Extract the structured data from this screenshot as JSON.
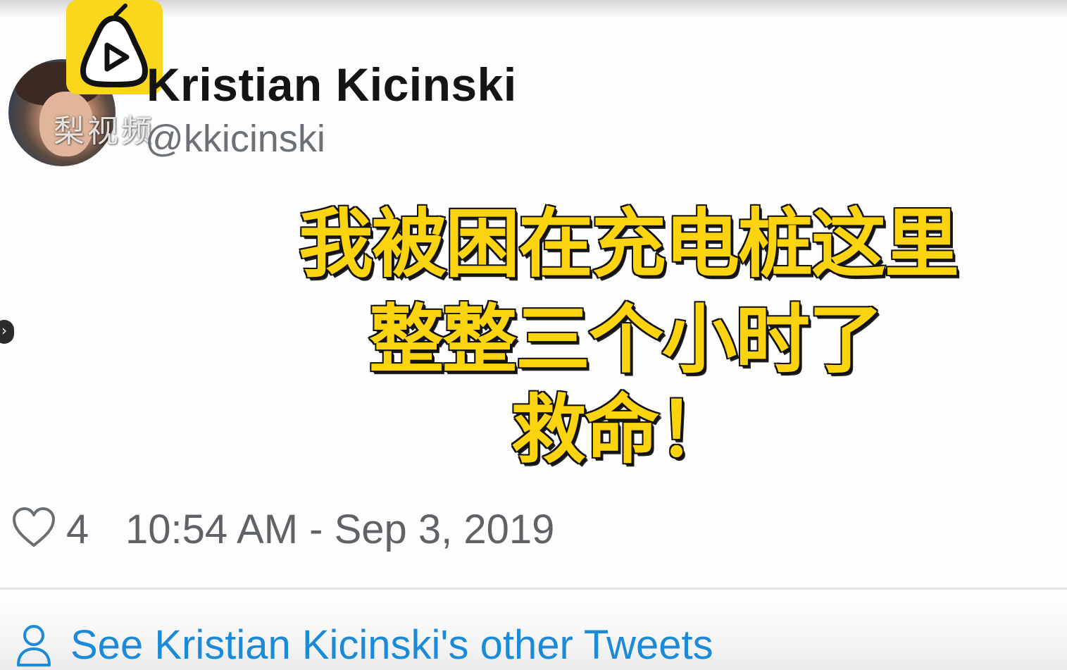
{
  "tweet": {
    "display_name": "Kristian Kicinski",
    "handle": "@kkicinski",
    "like_count": "4",
    "timestamp": "10:54 AM - Sep 3, 2019"
  },
  "caption": {
    "line1": "我被困在充电桩这里",
    "line2": "整整三个小时了",
    "line3": "救命！"
  },
  "watermark": {
    "logo_icon": "pear-play-icon",
    "text": "梨视频"
  },
  "footer": {
    "other_tweets_link": "See Kristian Kicinski's other Tweets",
    "icon": "person-icon"
  },
  "colors": {
    "caption_fill": "#fbd40f",
    "caption_outline": "#111111",
    "logo_bg": "#f9d71c",
    "link": "#1b8ad8",
    "meta_text": "#5f6368"
  }
}
